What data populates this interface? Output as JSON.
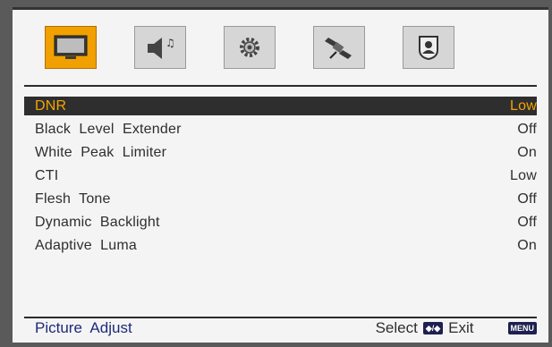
{
  "tabs": [
    {
      "icon": "picture-icon",
      "active": true
    },
    {
      "icon": "sound-icon",
      "active": false
    },
    {
      "icon": "settings-gear-icon",
      "active": false
    },
    {
      "icon": "satellite-icon",
      "active": false
    },
    {
      "icon": "parental-lock-icon",
      "active": false
    }
  ],
  "menu": {
    "items": [
      {
        "label": "DNR",
        "value": "Low"
      },
      {
        "label": "Black  Level  Extender",
        "value": "Off"
      },
      {
        "label": "White  Peak  Limiter",
        "value": "On"
      },
      {
        "label": "CTI",
        "value": "Low"
      },
      {
        "label": "Flesh  Tone",
        "value": "Off"
      },
      {
        "label": "Dynamic  Backlight",
        "value": "Off"
      },
      {
        "label": "Adaptive  Luma",
        "value": "On"
      }
    ]
  },
  "footer": {
    "title": "Picture  Adjust",
    "select_label": "Select",
    "select_key": "◆/◆",
    "exit_label": "Exit",
    "menu_key": "MENU"
  },
  "colors": {
    "accent": "#f0a000",
    "selected_bg": "#2e2e2e",
    "title_blue": "#1d2a7a"
  }
}
